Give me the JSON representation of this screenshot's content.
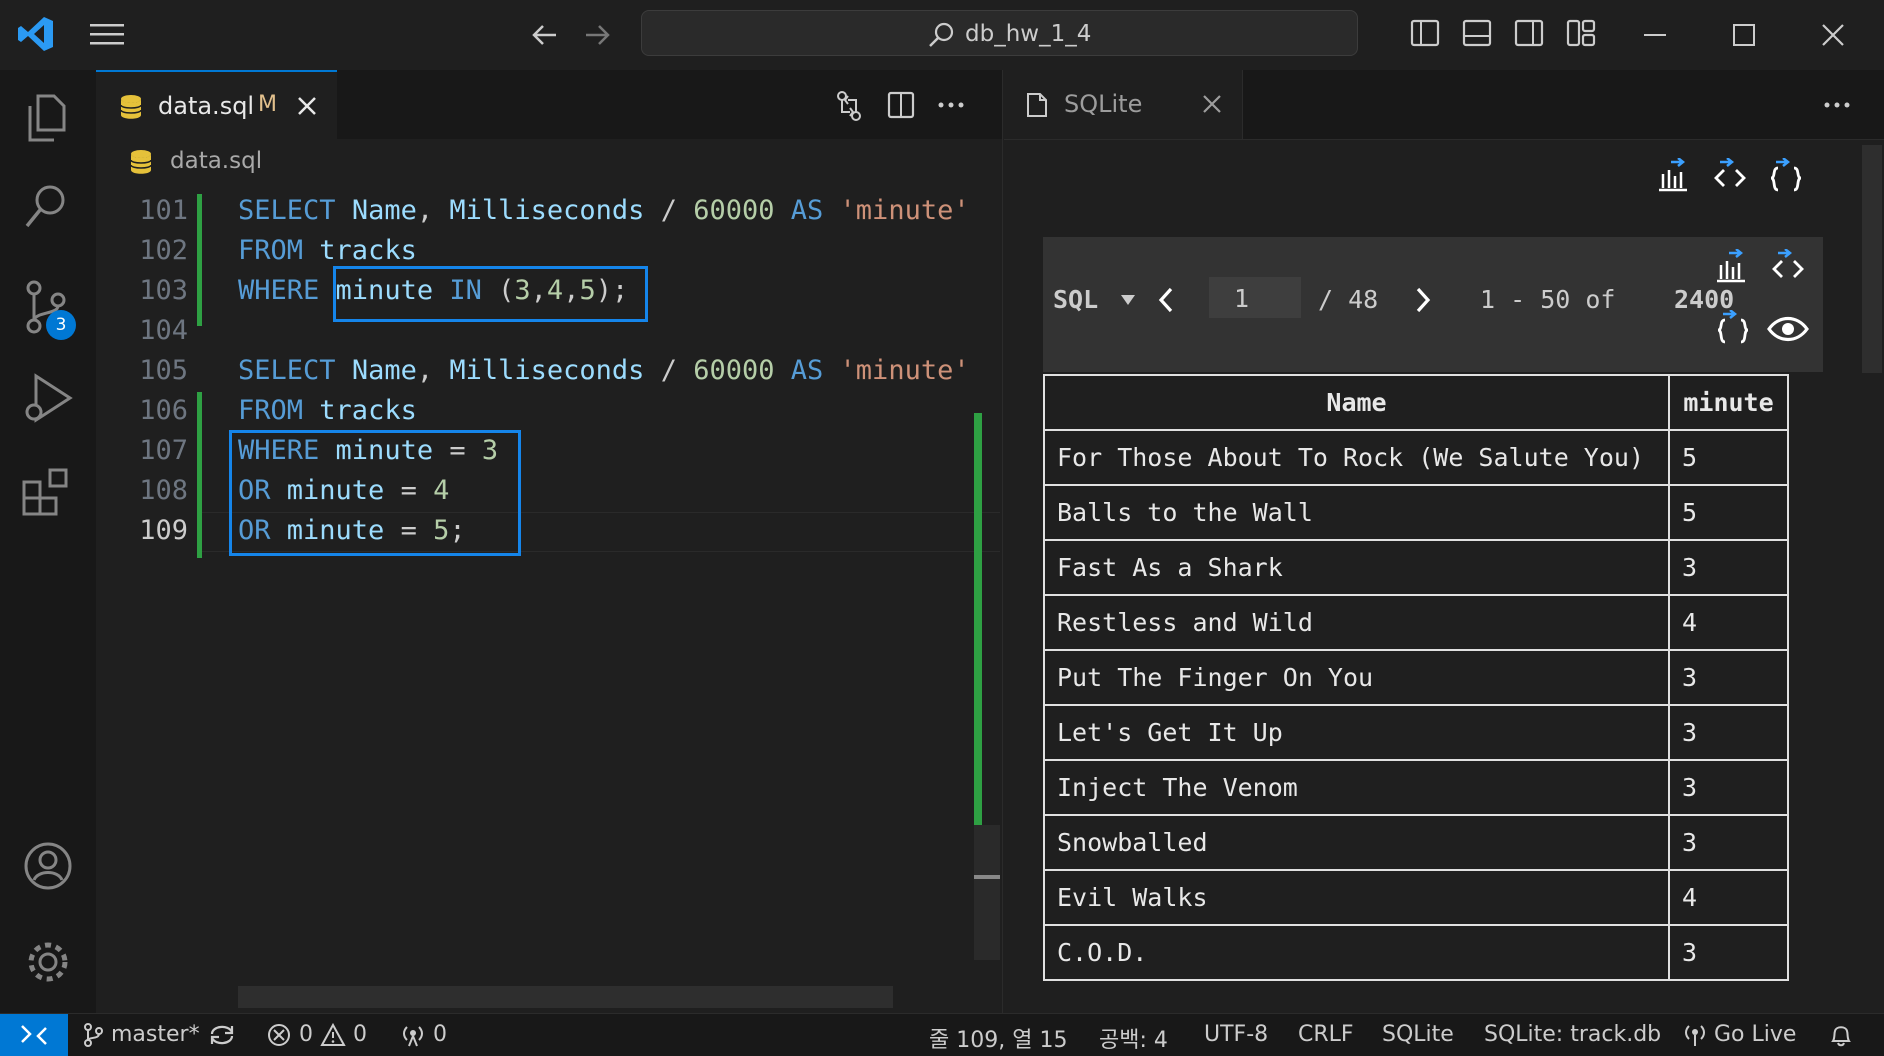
{
  "window": {
    "command_center": "db_hw_1_4"
  },
  "activity_bar": {
    "scm_badge": "3"
  },
  "editor": {
    "tab": {
      "filename": "data.sql",
      "modified_marker": "M"
    },
    "breadcrumb": "data.sql",
    "lines": [
      {
        "number": "101",
        "tokens": [
          [
            "kw",
            "SELECT"
          ],
          [
            "p",
            " "
          ],
          [
            "id",
            "Name"
          ],
          [
            "p",
            ", "
          ],
          [
            "id",
            "Milliseconds"
          ],
          [
            "p",
            " / "
          ],
          [
            "num",
            "60000"
          ],
          [
            "p",
            " "
          ],
          [
            "kw",
            "AS"
          ],
          [
            "p",
            " "
          ],
          [
            "str",
            "'minute'"
          ]
        ]
      },
      {
        "number": "102",
        "tokens": [
          [
            "kw",
            "FROM"
          ],
          [
            "p",
            " "
          ],
          [
            "id",
            "tracks"
          ]
        ]
      },
      {
        "number": "103",
        "tokens": [
          [
            "kw",
            "WHERE"
          ],
          [
            "p",
            " "
          ],
          [
            "id",
            "minute"
          ],
          [
            "p",
            " "
          ],
          [
            "kw",
            "IN"
          ],
          [
            "p",
            " ("
          ],
          [
            "num",
            "3"
          ],
          [
            "p",
            ","
          ],
          [
            "num",
            "4"
          ],
          [
            "p",
            ","
          ],
          [
            "num",
            "5"
          ],
          [
            "p",
            ");"
          ]
        ]
      },
      {
        "number": "104",
        "tokens": []
      },
      {
        "number": "105",
        "tokens": [
          [
            "kw",
            "SELECT"
          ],
          [
            "p",
            " "
          ],
          [
            "id",
            "Name"
          ],
          [
            "p",
            ", "
          ],
          [
            "id",
            "Milliseconds"
          ],
          [
            "p",
            " / "
          ],
          [
            "num",
            "60000"
          ],
          [
            "p",
            " "
          ],
          [
            "kw",
            "AS"
          ],
          [
            "p",
            " "
          ],
          [
            "str",
            "'minute'"
          ]
        ]
      },
      {
        "number": "106",
        "tokens": [
          [
            "kw",
            "FROM"
          ],
          [
            "p",
            " "
          ],
          [
            "id",
            "tracks"
          ]
        ]
      },
      {
        "number": "107",
        "tokens": [
          [
            "kw",
            "WHERE"
          ],
          [
            "p",
            " "
          ],
          [
            "id",
            "minute"
          ],
          [
            "p",
            " = "
          ],
          [
            "num",
            "3"
          ]
        ]
      },
      {
        "number": "108",
        "tokens": [
          [
            "kw",
            "OR"
          ],
          [
            "p",
            " "
          ],
          [
            "id",
            "minute"
          ],
          [
            "p",
            " = "
          ],
          [
            "num",
            "4"
          ]
        ]
      },
      {
        "number": "109",
        "tokens": [
          [
            "kw",
            "OR"
          ],
          [
            "p",
            " "
          ],
          [
            "id",
            "minute"
          ],
          [
            "p",
            " = "
          ],
          [
            "num",
            "5"
          ],
          [
            "p",
            ";"
          ]
        ]
      }
    ]
  },
  "sqlite_panel": {
    "tab_title": "SQLite",
    "toolbar": {
      "mode": "SQL",
      "page_input": "1",
      "page_total": "/ 48",
      "range": "1 - 50 of",
      "total": "2400"
    },
    "columns": [
      "Name",
      "minute"
    ],
    "rows": [
      [
        "For Those About To Rock (We Salute You)",
        "5"
      ],
      [
        "Balls to the Wall",
        "5"
      ],
      [
        "Fast As a Shark",
        "3"
      ],
      [
        "Restless and Wild",
        "4"
      ],
      [
        "Put The Finger On You",
        "3"
      ],
      [
        "Let's Get It Up",
        "3"
      ],
      [
        "Inject The Venom",
        "3"
      ],
      [
        "Snowballed",
        "3"
      ],
      [
        "Evil Walks",
        "4"
      ],
      [
        "C.O.D.",
        "3"
      ]
    ]
  },
  "status_bar": {
    "branch": "master*",
    "errors": "0",
    "warnings": "0",
    "ports": "0",
    "cursor": "줄 109, 열 15",
    "indent": "공백: 4",
    "encoding": "UTF-8",
    "eol": "CRLF",
    "language": "SQLite",
    "db": "SQLite: track.db",
    "golive": "Go Live"
  }
}
